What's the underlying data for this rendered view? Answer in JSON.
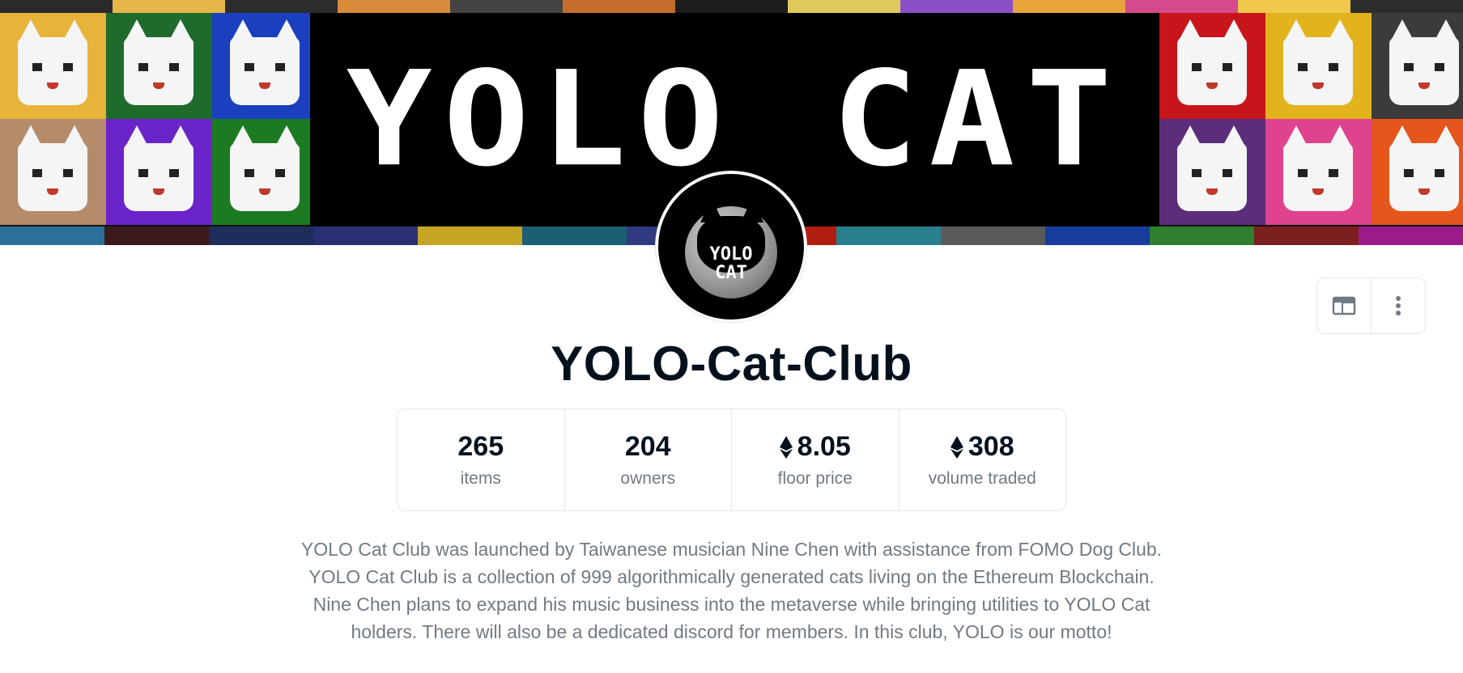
{
  "banner": {
    "logo_text": "YOLO CAT",
    "tile_colors_left": [
      "#e8b33a",
      "#1f6b2c",
      "#1a3fbf",
      "#b48c6c",
      "#6a24c9",
      "#1c7a23"
    ],
    "tile_colors_right": [
      "#c8151b",
      "#e2b31d",
      "#3b3b3b",
      "#5b2d7a",
      "#e0438e",
      "#e6561c"
    ],
    "strip_colors": [
      "#2a2a2a",
      "#e6b74b",
      "#2c2c2c",
      "#d98a3a",
      "#444444",
      "#c56d2a",
      "#1d1d1d",
      "#e0c95b",
      "#8a4fc7",
      "#e8a43a",
      "#d44a8c",
      "#f0c84b",
      "#2d2d2d"
    ],
    "bottom_strip_colors": [
      "#2b6f9a",
      "#3a1a1a",
      "#1e2d5c",
      "#2a2f73",
      "#c6a524",
      "#1a5f74",
      "#2f3a80",
      "#b21d12",
      "#2a7f8f",
      "#5a5a5a",
      "#163d9c",
      "#2f7f2f",
      "#7b1f1f",
      "#9c1b8a"
    ]
  },
  "avatar": {
    "line1": "YOLO",
    "line2": "CAT"
  },
  "actions": {
    "layout_icon": "browser-window-icon",
    "more_icon": "more-vertical-icon"
  },
  "collection": {
    "name": "YOLO-Cat-Club"
  },
  "stats": [
    {
      "value": "265",
      "label": "items",
      "eth": false
    },
    {
      "value": "204",
      "label": "owners",
      "eth": false
    },
    {
      "value": "8.05",
      "label": "floor price",
      "eth": true
    },
    {
      "value": "308",
      "label": "volume traded",
      "eth": true
    }
  ],
  "description": "YOLO Cat Club was launched by Taiwanese musician Nine Chen with assistance from FOMO Dog Club. YOLO Cat Club is a collection of 999 algorithmically generated cats living on the Ethereum Blockchain. Nine Chen plans to expand his music business into the metaverse while bringing utilities to YOLO Cat holders. There will also be a dedicated discord for members. In this club, YOLO is our motto!",
  "colors": {
    "text_primary": "#04111d",
    "text_secondary": "#707a83",
    "border": "#e5e8eb"
  }
}
